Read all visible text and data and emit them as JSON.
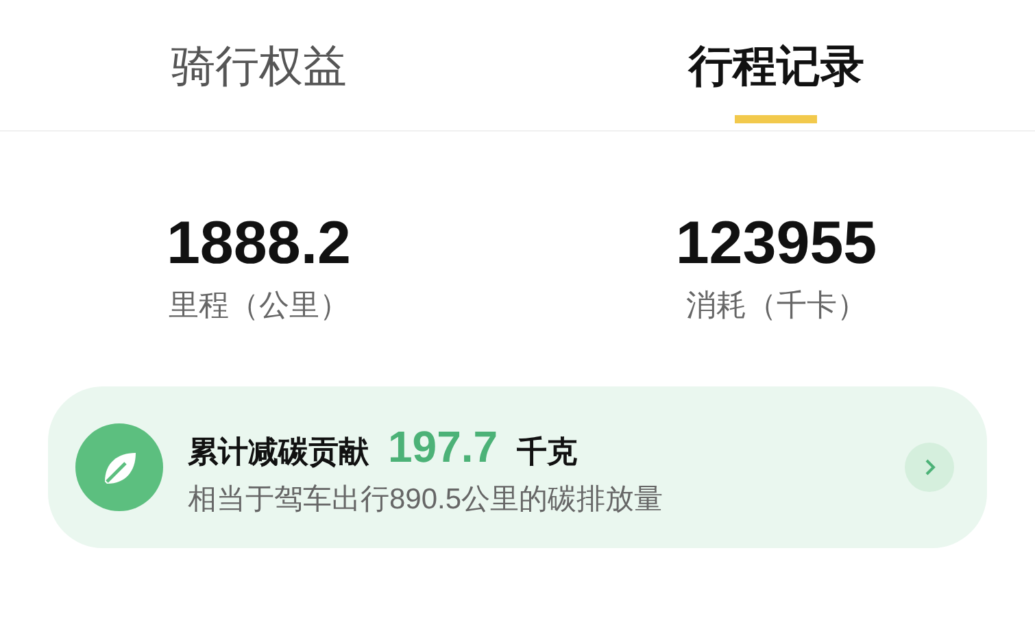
{
  "tabs": [
    {
      "label": "骑行权益",
      "selected": false
    },
    {
      "label": "行程记录",
      "selected": true
    }
  ],
  "stats": [
    {
      "value": "1888.2",
      "label": "里程（公里）"
    },
    {
      "value": "123955",
      "label": "消耗（千卡）"
    }
  ],
  "carbon_card": {
    "title": "累计减碳贡献",
    "amount": "197.7",
    "unit": "千克",
    "description": "相当于驾车出行890.5公里的碳排放量"
  }
}
